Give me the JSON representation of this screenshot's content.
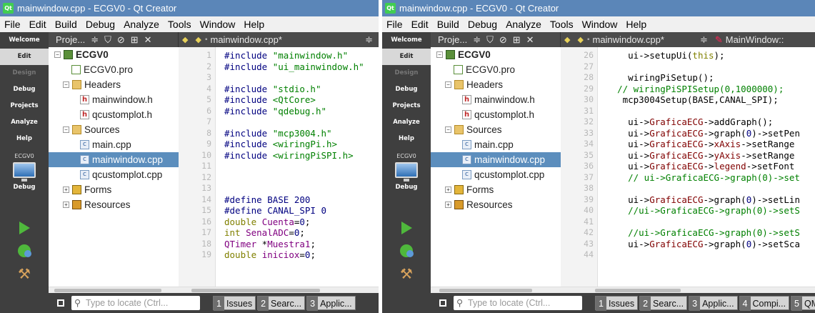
{
  "windows": [
    {
      "title": "mainwindow.cpp - ECGV0 - Qt Creator",
      "menu": {
        "file": "File",
        "edit": "Edit",
        "build": "Build",
        "debug": "Debug",
        "analyze": "Analyze",
        "tools": "Tools",
        "window": "Window",
        "help": "Help"
      },
      "modes": {
        "welcome": "Welcome",
        "edit": "Edit",
        "design": "Design",
        "debug": "Debug",
        "projects": "Projects",
        "analyze": "Analyze",
        "help": "Help",
        "kit": "ECGV0",
        "kit_build": "Debug"
      },
      "toolbar": {
        "projects": "Proje...",
        "file": "mainwindow.cpp*"
      },
      "tree": {
        "project": "ECGV0",
        "pro": "ECGV0.pro",
        "headers": "Headers",
        "h1": "mainwindow.h",
        "h2": "qcustomplot.h",
        "sources": "Sources",
        "s1": "main.cpp",
        "s2": "mainwindow.cpp",
        "s3": "qcustomplot.cpp",
        "forms": "Forms",
        "resources": "Resources"
      },
      "code": [
        {
          "n": "1",
          "t": "#include \"mainwindow.h\""
        },
        {
          "n": "2",
          "t": "#include \"ui_mainwindow.h\""
        },
        {
          "n": "3",
          "t": ""
        },
        {
          "n": "4",
          "t": "#include \"stdio.h\""
        },
        {
          "n": "5",
          "t": "#include <QtCore>"
        },
        {
          "n": "6",
          "t": "#include \"qdebug.h\""
        },
        {
          "n": "7",
          "t": ""
        },
        {
          "n": "8",
          "t": "#include \"mcp3004.h\""
        },
        {
          "n": "9",
          "t": "#include <wiringPi.h>"
        },
        {
          "n": "10",
          "t": "#include <wiringPiSPI.h>"
        },
        {
          "n": "11",
          "t": ""
        },
        {
          "n": "12",
          "t": ""
        },
        {
          "n": "13",
          "t": ""
        },
        {
          "n": "14",
          "t": "#define BASE 200"
        },
        {
          "n": "15",
          "t": "#define CANAL_SPI 0"
        },
        {
          "n": "16",
          "t": "double Cuenta=0;"
        },
        {
          "n": "17",
          "t": "int SenalADC=0;"
        },
        {
          "n": "18",
          "t": "QTimer *Muestra1;"
        },
        {
          "n": "19",
          "t": "double iniciox=0;"
        }
      ],
      "status": {
        "locate": "Type to locate (Ctrl...",
        "tabs": [
          {
            "n": "1",
            "label": "Issues"
          },
          {
            "n": "2",
            "label": "Searc..."
          },
          {
            "n": "3",
            "label": "Applic..."
          }
        ]
      }
    },
    {
      "title": "mainwindow.cpp - ECGV0 - Qt Creator",
      "menu": {
        "file": "File",
        "edit": "Edit",
        "build": "Build",
        "debug": "Debug",
        "analyze": "Analyze",
        "tools": "Tools",
        "window": "Window",
        "help": "Help"
      },
      "modes": {
        "welcome": "Welcome",
        "edit": "Edit",
        "design": "Design",
        "debug": "Debug",
        "projects": "Projects",
        "analyze": "Analyze",
        "help": "Help",
        "kit": "ECGV0",
        "kit_build": "Debug"
      },
      "toolbar": {
        "projects": "Proje...",
        "file": "mainwindow.cpp*",
        "symbol": "MainWindow::"
      },
      "tree": {
        "project": "ECGV0",
        "pro": "ECGV0.pro",
        "headers": "Headers",
        "h1": "mainwindow.h",
        "h2": "qcustomplot.h",
        "sources": "Sources",
        "s1": "main.cpp",
        "s2": "mainwindow.cpp",
        "s3": "qcustomplot.cpp",
        "forms": "Forms",
        "resources": "Resources"
      },
      "code": [
        {
          "n": "26",
          "t": "    ui->setupUi(this);"
        },
        {
          "n": "27",
          "t": ""
        },
        {
          "n": "28",
          "t": "    wiringPiSetup();"
        },
        {
          "n": "29",
          "t": "  // wiringPiSPISetup(0,1000000);"
        },
        {
          "n": "30",
          "t": "   mcp3004Setup(BASE,CANAL_SPI);"
        },
        {
          "n": "31",
          "t": ""
        },
        {
          "n": "32",
          "t": "    ui->GraficaECG->addGraph();"
        },
        {
          "n": "33",
          "t": "    ui->GraficaECG->graph(0)->setPen"
        },
        {
          "n": "34",
          "t": "    ui->GraficaECG->xAxis->setRange"
        },
        {
          "n": "35",
          "t": "    ui->GraficaECG->yAxis->setRange"
        },
        {
          "n": "36",
          "t": "    ui->GraficaECG->legend->setFont"
        },
        {
          "n": "37",
          "t": "    // ui->GraficaECG->graph(0)->set"
        },
        {
          "n": "38",
          "t": ""
        },
        {
          "n": "39",
          "t": "    ui->GraficaECG->graph(0)->setLin"
        },
        {
          "n": "40",
          "t": "    //ui->GraficaECG->graph(0)->setS"
        },
        {
          "n": "41",
          "t": ""
        },
        {
          "n": "42",
          "t": "    //ui->GraficaECG->graph(0)->setS"
        },
        {
          "n": "43",
          "t": "    ui->GraficaECG->graph(0)->setSca"
        },
        {
          "n": "44",
          "t": ""
        }
      ],
      "status": {
        "locate": "Type to locate (Ctrl...",
        "tabs": [
          {
            "n": "1",
            "label": "Issues"
          },
          {
            "n": "2",
            "label": "Searc..."
          },
          {
            "n": "3",
            "label": "Applic..."
          },
          {
            "n": "4",
            "label": "Compi..."
          },
          {
            "n": "5",
            "label": "QML..."
          }
        ]
      }
    }
  ]
}
